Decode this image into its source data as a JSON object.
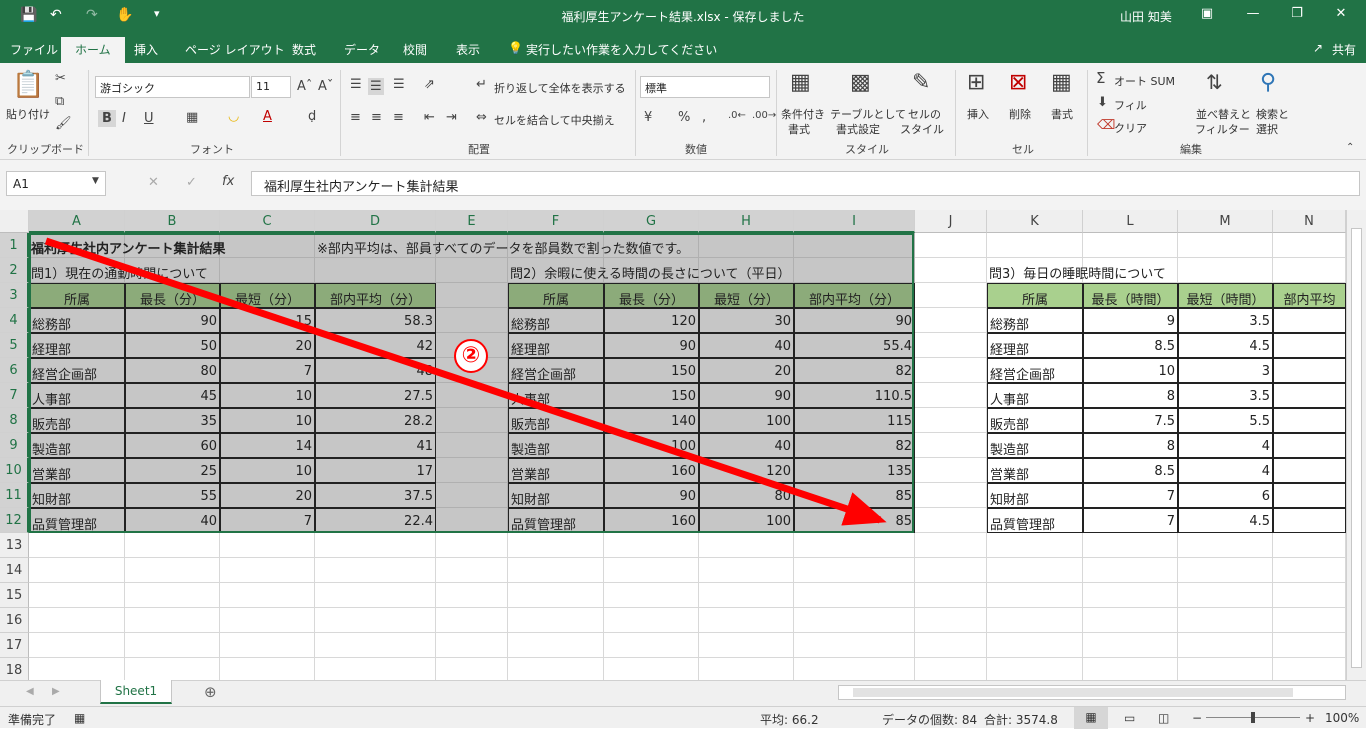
{
  "titlebar": {
    "title": "福利厚生アンケート結果.xlsx  -  保存しました",
    "user": "山田 知美"
  },
  "menu_tabs": [
    "ファイル",
    "ホーム",
    "挿入",
    "ページ レイアウト",
    "数式",
    "データ",
    "校閲",
    "表示"
  ],
  "tell_me": "実行したい作業を入力してください",
  "share": "共有",
  "ribbon": {
    "paste": "貼り付け",
    "font_name": "游ゴシック",
    "font_size": "11",
    "wrap_text": "折り返して全体を表示する",
    "merge_center": "セルを結合して中央揃え",
    "number_format": "標準",
    "conditional": "条件付き",
    "conditional2": "書式",
    "as_table": "テーブルとして",
    "as_table2": "書式設定",
    "cell_style": "セルの",
    "cell_style2": "スタイル",
    "insert": "挿入",
    "delete": "削除",
    "format": "書式",
    "autosum": "オート SUM",
    "fill": "フィル",
    "clear": "クリア",
    "sort": "並べ替えと",
    "sort2": "フィルター",
    "find": "検索と",
    "find2": "選択",
    "groups": {
      "clipboard": "クリップボード",
      "font": "フォント",
      "alignment": "配置",
      "number": "数値",
      "styles": "スタイル",
      "cells": "セル",
      "editing": "編集"
    }
  },
  "formula_bar": {
    "name_box": "A1",
    "formula": "福利厚生社内アンケート集計結果"
  },
  "columns": [
    "A",
    "B",
    "C",
    "D",
    "E",
    "F",
    "G",
    "H",
    "I",
    "J",
    "K",
    "L",
    "M",
    "N"
  ],
  "rows": [
    "1",
    "2",
    "3",
    "4",
    "5",
    "6",
    "7",
    "8",
    "9",
    "10",
    "11",
    "12",
    "13",
    "14",
    "15",
    "16",
    "17",
    "18"
  ],
  "sheet": {
    "title": "福利厚生社内アンケート集計結果",
    "note": "※部内平均は、部員すべてのデータを部員数で割った数値です。",
    "q1_title": "問1）現在の通勤時間について",
    "q2_title": "問2）余暇に使える時間の長さについて（平日）",
    "q3_title": "問3）毎日の睡眠時間について",
    "q1_headers": [
      "所属",
      "最長（分）",
      "最短（分）",
      "部内平均（分）"
    ],
    "q2_headers": [
      "所属",
      "最長（分）",
      "最短（分）",
      "部内平均（分）"
    ],
    "q3_headers": [
      "所属",
      "最長（時間）",
      "最短（時間）",
      "部内平均"
    ],
    "departments": [
      "総務部",
      "経理部",
      "経営企画部",
      "人事部",
      "販売部",
      "製造部",
      "営業部",
      "知財部",
      "品質管理部"
    ],
    "q1_data": [
      [
        "90",
        "15",
        "58.3"
      ],
      [
        "50",
        "20",
        "42"
      ],
      [
        "80",
        "7",
        "48"
      ],
      [
        "45",
        "10",
        "27.5"
      ],
      [
        "35",
        "10",
        "28.2"
      ],
      [
        "60",
        "14",
        "41"
      ],
      [
        "25",
        "10",
        "17"
      ],
      [
        "55",
        "20",
        "37.5"
      ],
      [
        "40",
        "7",
        "22.4"
      ]
    ],
    "q2_data": [
      [
        "120",
        "30",
        "90"
      ],
      [
        "90",
        "40",
        "55.4"
      ],
      [
        "150",
        "20",
        "82"
      ],
      [
        "150",
        "90",
        "110.5"
      ],
      [
        "140",
        "100",
        "115"
      ],
      [
        "100",
        "40",
        "82"
      ],
      [
        "160",
        "120",
        "135"
      ],
      [
        "90",
        "80",
        "85"
      ],
      [
        "160",
        "100",
        "85"
      ]
    ],
    "q3_data": [
      [
        "9",
        "3.5"
      ],
      [
        "8.5",
        "4.5"
      ],
      [
        "10",
        "3"
      ],
      [
        "8",
        "3.5"
      ],
      [
        "7.5",
        "5.5"
      ],
      [
        "8",
        "4"
      ],
      [
        "8.5",
        "4"
      ],
      [
        "7",
        "6"
      ],
      [
        "7",
        "4.5"
      ]
    ]
  },
  "annotation": {
    "badge": "②"
  },
  "sheet_tab": "Sheet1",
  "status": {
    "ready": "準備完了",
    "average": "平均: 66.2",
    "count": "データの個数: 84",
    "sum": "合計: 3574.8",
    "zoom": "100%"
  },
  "colors": {
    "accent": "#217346",
    "header_fill": "#a9d08e",
    "selection": "#c6c6c6",
    "arrow": "#ff0000"
  }
}
